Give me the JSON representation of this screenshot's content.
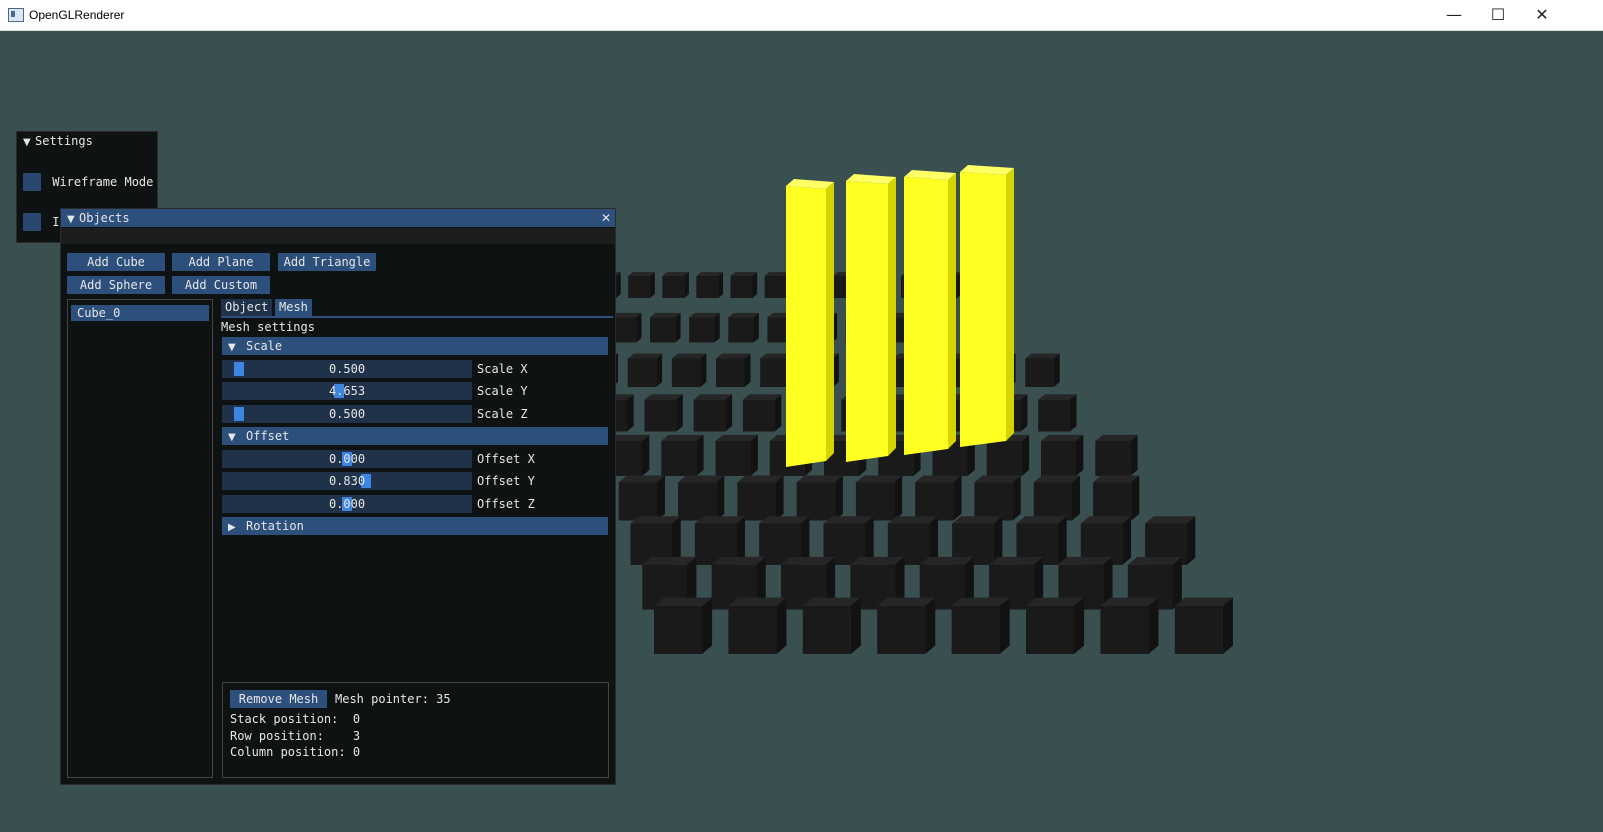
{
  "window": {
    "title": "OpenGLRenderer",
    "minimize": "—",
    "maximize": "☐",
    "close": "✕"
  },
  "colors": {
    "bg": "#3a4f4f",
    "highlight": "#ffff22",
    "cube": "#1a1a1a",
    "accent": "#2d4f7c",
    "grab": "#3d85e0"
  },
  "settings": {
    "title": "Settings",
    "items": [
      {
        "label": "Wireframe Mode"
      },
      {
        "label": "In"
      }
    ]
  },
  "objects": {
    "title": "Objects",
    "buttons": {
      "add_cube": "Add Cube",
      "add_plane": "Add Plane",
      "add_triangle": "Add Triangle",
      "add_sphere": "Add Sphere",
      "add_custom": "Add Custom"
    },
    "list": [
      "Cube_0"
    ],
    "tabs": [
      "Object",
      "Mesh"
    ],
    "active_tab": "Mesh",
    "mesh_settings_label": "Mesh settings",
    "scale": {
      "header": "Scale",
      "sliders": [
        {
          "label": "Scale X",
          "value": "0.500",
          "fraction": 0.05
        },
        {
          "label": "Scale Y",
          "value": "4.653",
          "fraction": 0.465
        },
        {
          "label": "Scale Z",
          "value": "0.500",
          "fraction": 0.05
        }
      ]
    },
    "offset": {
      "header": "Offset",
      "sliders": [
        {
          "label": "Offset X",
          "value": "0.000",
          "fraction": 0.5
        },
        {
          "label": "Offset Y",
          "value": "0.830",
          "fraction": 0.58
        },
        {
          "label": "Offset Z",
          "value": "0.000",
          "fraction": 0.5
        }
      ]
    },
    "rotation": {
      "header": "Rotation"
    },
    "info": {
      "remove_button": "Remove Mesh",
      "mesh_pointer": "Mesh pointer: 35",
      "stack": "Stack position:  0",
      "row": "Row position:    3",
      "column": "Column position: 0"
    }
  }
}
